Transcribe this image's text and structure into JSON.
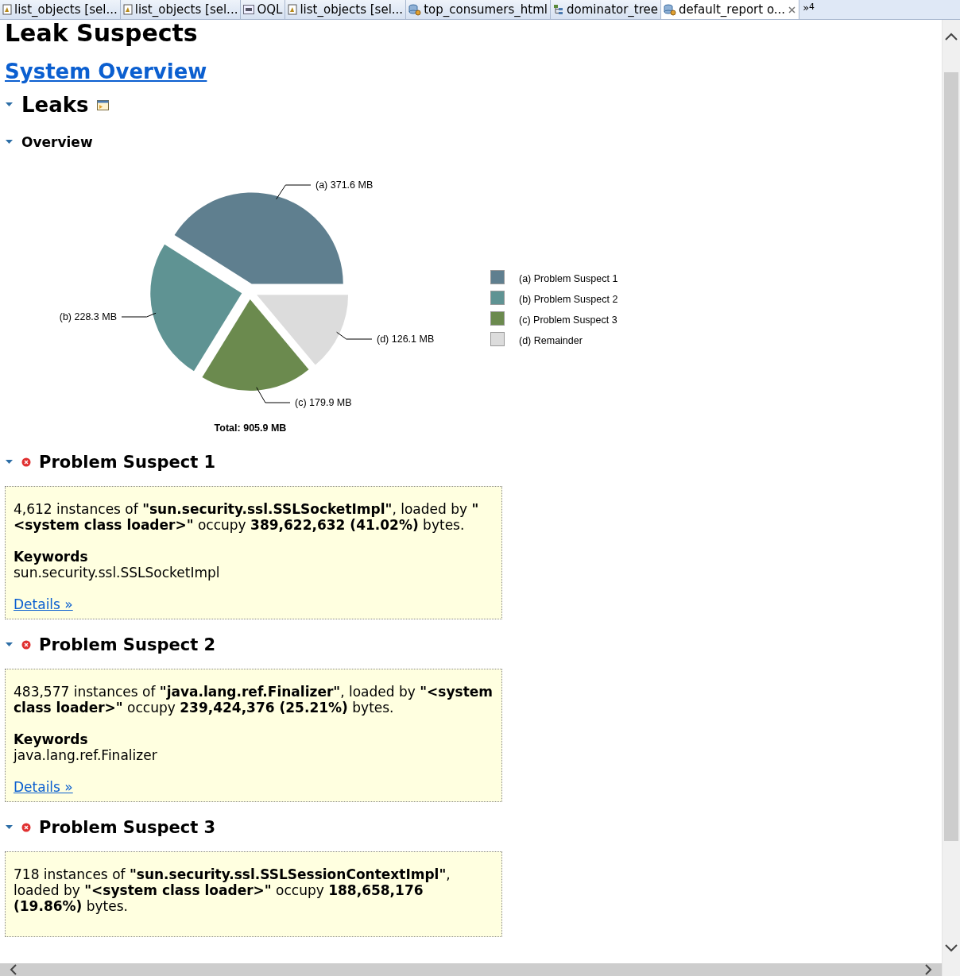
{
  "tabs": [
    {
      "label": "list_objects [sel...",
      "kind": "document",
      "selected": false
    },
    {
      "label": "list_objects [sel...",
      "kind": "document",
      "selected": false
    },
    {
      "label": "OQL",
      "kind": "query",
      "selected": false
    },
    {
      "label": "list_objects [sel...",
      "kind": "document",
      "selected": false
    },
    {
      "label": "top_consumers_html",
      "kind": "report",
      "selected": false
    },
    {
      "label": "dominator_tree",
      "kind": "tree",
      "selected": false
    },
    {
      "label": "default_report  o...",
      "kind": "report",
      "selected": true
    }
  ],
  "tab_overflow": {
    "arrow": "»",
    "count": "4"
  },
  "page": {
    "title": "Leak Suspects",
    "link": "System Overview",
    "section": {
      "title": "Leaks",
      "expanded": true,
      "overview": {
        "title": "Overview",
        "expanded": true,
        "chart_data": {
          "type": "pie",
          "categories": [
            "(a)  Problem Suspect 1",
            "(b)  Problem Suspect 2",
            "(c)  Problem Suspect 3",
            "(d)  Remainder"
          ],
          "values": [
            371.6,
            228.3,
            179.9,
            126.1
          ],
          "colors": [
            "#5f7f8f",
            "#5f9393",
            "#6b8a4e",
            "#dcdcdc"
          ],
          "legend": "right",
          "value_labels": [
            "(a)  371.6 MB",
            "(b)  228.3 MB",
            "(c)  179.9 MB",
            "(d)  126.1 MB"
          ],
          "annotations": [
            "Total: 905.9 MB"
          ]
        }
      },
      "suspects": [
        {
          "title": "Problem Suspect 1",
          "expanded": true,
          "description": "4,612 instances of **\"sun.security.ssl.SSLSocketImpl\"**, loaded by **\"<system class loader>\"** occupy **389,622,632 (41.02%)** bytes.",
          "keywords_label": "Keywords",
          "keywords": "sun.security.ssl.SSLSocketImpl",
          "details": "Details »"
        },
        {
          "title": "Problem Suspect 2",
          "expanded": true,
          "description": "483,577 instances of **\"java.lang.ref.Finalizer\"**, loaded by **\"<system class loader>\"** occupy **239,424,376 (25.21%)** bytes.",
          "keywords_label": "Keywords",
          "keywords": "java.lang.ref.Finalizer",
          "details": "Details »"
        },
        {
          "title": "Problem Suspect 3",
          "expanded": true,
          "description": "718 instances of **\"sun.security.ssl.SSLSessionContextImpl\"**, loaded by **\"<system class loader>\"** occupy **188,658,176 (19.86%)** bytes."
        }
      ]
    }
  }
}
